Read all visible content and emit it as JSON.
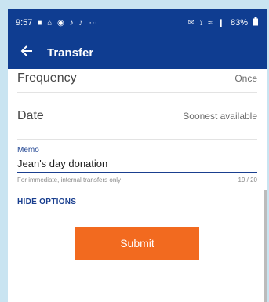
{
  "status_bar": {
    "time": "9:57",
    "battery": "83%",
    "notification_icons": "■ ⌂ ◉ ♪ ♪",
    "ellipsis": "···",
    "system_icons": "✉ ⟟ ≈ ❙"
  },
  "app_bar": {
    "back_icon": "arrow-left-icon",
    "title": "Transfer"
  },
  "form": {
    "frequency": {
      "label": "Frequency",
      "value": "Once"
    },
    "date": {
      "label": "Date",
      "value": "Soonest available"
    },
    "memo": {
      "label": "Memo",
      "value": "Jean's day donation",
      "helper": "For immediate, internal transfers only",
      "counter": "19 / 20"
    },
    "hide_options_label": "HIDE OPTIONS",
    "submit_label": "Submit"
  },
  "colors": {
    "primary": "#0f3d91",
    "accent": "#f26a1f",
    "background": "#c9e4f1"
  }
}
